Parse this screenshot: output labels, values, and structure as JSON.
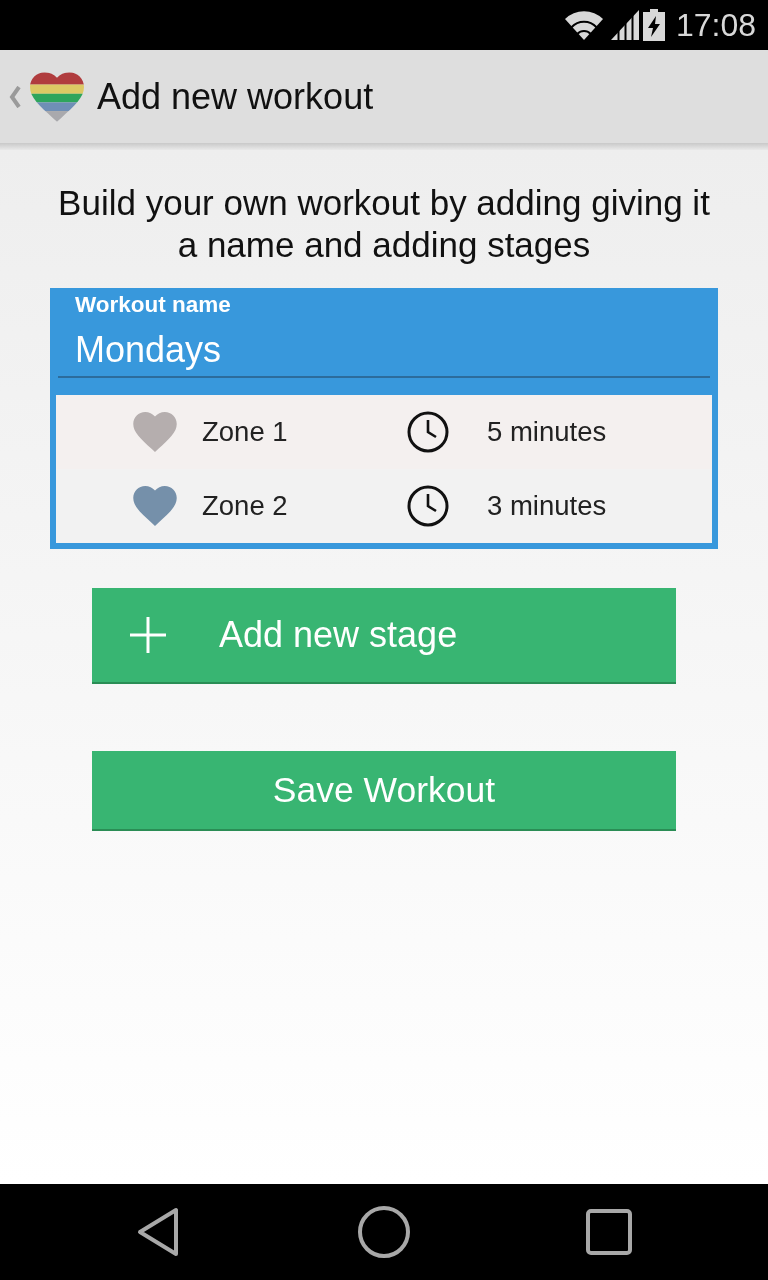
{
  "status_bar": {
    "time": "17:08"
  },
  "action_bar": {
    "title": "Add new workout"
  },
  "intro": "Build your own workout by adding giving it a name and adding stages",
  "workout_name": {
    "label": "Workout name",
    "value": "Mondays"
  },
  "stages": [
    {
      "zone": "Zone 1",
      "color": "#b5aeae",
      "duration": "5 minutes"
    },
    {
      "zone": "Zone 2",
      "color": "#7590aa",
      "duration": "3 minutes"
    }
  ],
  "buttons": [
    {
      "kind": "add",
      "label": "Add new stage"
    },
    {
      "kind": "save",
      "label": "Save Workout"
    }
  ]
}
